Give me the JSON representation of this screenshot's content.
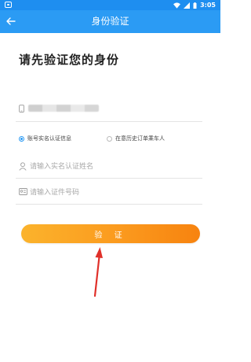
{
  "status_bar": {
    "time": "3:05"
  },
  "app_bar": {
    "title": "身份验证"
  },
  "page": {
    "heading": "请先验证您的身份"
  },
  "form": {
    "radio_options": [
      {
        "label": "账号实名认证信息",
        "selected": true
      },
      {
        "label": "在意历史订单乘车人",
        "selected": false
      }
    ],
    "name_placeholder": "请输入实名认证姓名",
    "id_placeholder": "请输入证件号码",
    "submit_label": "验 证"
  },
  "colors": {
    "status_bar": "#1e8ef0",
    "app_bar": "#2b9bf4",
    "button_start": "#fbb32c",
    "button_end": "#f7830f",
    "annotation_arrow": "#e0302a"
  }
}
